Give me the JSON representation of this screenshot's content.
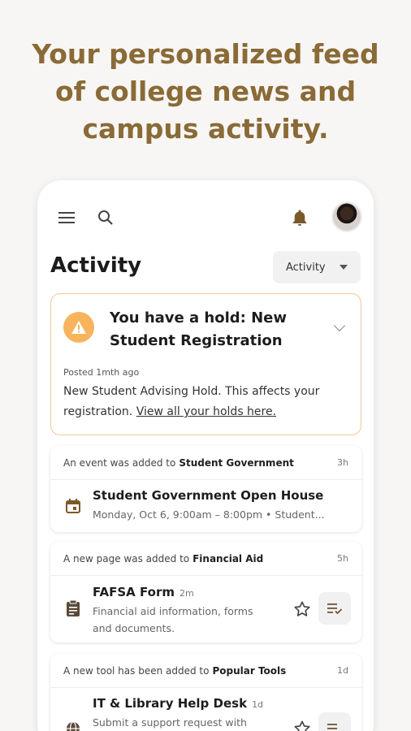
{
  "headline": {
    "line1": "Your personalized feed",
    "line2": "of college news and",
    "line3": "campus activity."
  },
  "topbar": {
    "icons": [
      "menu-icon",
      "search-icon",
      "bell-icon",
      "avatar"
    ]
  },
  "page": {
    "title": "Activity",
    "filter_label": "Activity"
  },
  "hold": {
    "title": "You have a hold: New Student Registration",
    "posted": "Posted 1mth ago",
    "body": "New Student Advising Hold. This affects your registration.",
    "link": "View all your holds here."
  },
  "cards": [
    {
      "prefix": "An event was added to",
      "group": "Student Government",
      "time": "3h",
      "title": "Student Government Open House",
      "subtitle": "Monday, Oct 6, 9:00am – 8:00pm • Student..."
    },
    {
      "prefix": "A new page was added to",
      "group": "Financial Aid",
      "time": "5h",
      "title": "FAFSA Form",
      "ago": "2m",
      "subtitle_line1": "Financial aid information, forms",
      "subtitle_line2": "and documents."
    },
    {
      "prefix": "A new tool has been added to",
      "group": "Popular Tools",
      "time": "1d",
      "title": "IT & Library Help Desk",
      "ago": "1d",
      "subtitle_line1": "Submit a support request with"
    }
  ],
  "colors": {
    "accent": "#8a6a36",
    "warning": "#f7b45d",
    "hold_border": "#f2c79a"
  }
}
